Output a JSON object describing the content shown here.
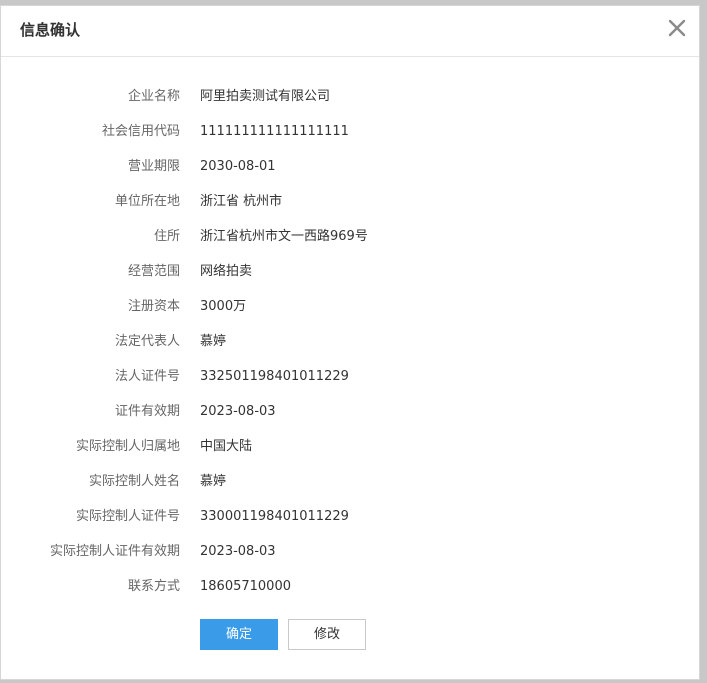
{
  "dialog": {
    "title": "信息确认",
    "close_icon": "close-icon"
  },
  "fields": [
    {
      "label": "企业名称",
      "value": "阿里拍卖测试有限公司"
    },
    {
      "label": "社会信用代码",
      "value": "111111111111111111"
    },
    {
      "label": "营业期限",
      "value": "2030-08-01"
    },
    {
      "label": "单位所在地",
      "value": "浙江省 杭州市"
    },
    {
      "label": "住所",
      "value": "浙江省杭州市文一西路969号"
    },
    {
      "label": "经营范围",
      "value": "网络拍卖"
    },
    {
      "label": "注册资本",
      "value": "3000万"
    },
    {
      "label": "法定代表人",
      "value": "慕婷"
    },
    {
      "label": "法人证件号",
      "value": "332501198401011229"
    },
    {
      "label": "证件有效期",
      "value": "2023-08-03"
    },
    {
      "label": "实际控制人归属地",
      "value": "中国大陆"
    },
    {
      "label": "实际控制人姓名",
      "value": "慕婷"
    },
    {
      "label": "实际控制人证件号",
      "value": "330001198401011229"
    },
    {
      "label": "实际控制人证件有效期",
      "value": "2023-08-03"
    },
    {
      "label": "联系方式",
      "value": "18605710000"
    }
  ],
  "buttons": {
    "confirm_label": "确定",
    "modify_label": "修改"
  },
  "colors": {
    "primary": "#3a9ce8",
    "label_text": "#666666",
    "value_text": "#333333"
  }
}
